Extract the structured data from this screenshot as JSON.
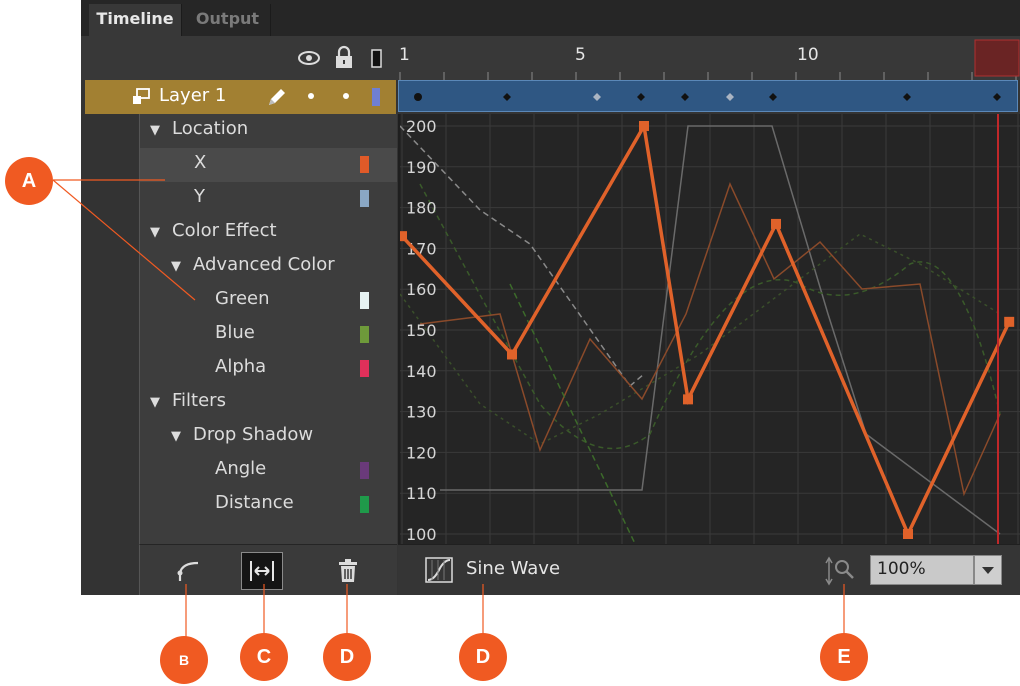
{
  "tabs": [
    {
      "label": "Timeline",
      "active": true
    },
    {
      "label": "Output",
      "active": false
    }
  ],
  "header": {
    "icons": [
      "eye-icon",
      "lock-icon",
      "outline-icon"
    ],
    "ruler_labels": [
      "1",
      "5",
      "10"
    ]
  },
  "layer": {
    "name": "Layer 1",
    "icons": [
      "layer-icon",
      "pencil-icon"
    ]
  },
  "tree": {
    "rows": [
      {
        "label": "Location",
        "level": 0,
        "expandable": true
      },
      {
        "label": "X",
        "level": 1,
        "swatch": "#e05a28",
        "selected": true
      },
      {
        "label": "Y",
        "level": 1,
        "swatch": "#8aa7c4"
      },
      {
        "label": "Color Effect",
        "level": 0,
        "expandable": true
      },
      {
        "label": "Advanced Color",
        "level": 1,
        "expandable": true
      },
      {
        "label": "Green",
        "level": 2,
        "swatch": "#e6f2f2"
      },
      {
        "label": "Blue",
        "level": 2,
        "swatch": "#6e9a3a"
      },
      {
        "label": "Alpha",
        "level": 2,
        "swatch": "#e0305a"
      },
      {
        "label": "Filters",
        "level": 0,
        "expandable": true
      },
      {
        "label": "Drop Shadow",
        "level": 1,
        "expandable": true
      },
      {
        "label": "Angle",
        "level": 2,
        "swatch": "#6a3a7a"
      },
      {
        "label": "Distance",
        "level": 2,
        "swatch": "#1f9a4a"
      }
    ]
  },
  "footer": {
    "icons": [
      "add-ease-icon",
      "fit-view-icon",
      "trash-icon"
    ],
    "ease_icon": "ease-curve-icon",
    "ease_label": "Sine Wave",
    "zoom_icon": "vertical-zoom-icon",
    "zoom_value": "100%",
    "dropdown_icon": "chevron-down-icon"
  },
  "graph": {
    "y_ticks": [
      "200",
      "190",
      "180",
      "170",
      "160",
      "150",
      "140",
      "130",
      "120",
      "110",
      "100"
    ],
    "series_x": [
      {
        "frame": 1,
        "value": 173
      },
      {
        "frame": 3.5,
        "value": 144
      },
      {
        "frame": 6.5,
        "value": 200
      },
      {
        "frame": 7.5,
        "value": 133
      },
      {
        "frame": 9.5,
        "value": 176
      },
      {
        "frame": 12.5,
        "value": 100
      },
      {
        "frame": 14.8,
        "value": 152
      }
    ]
  },
  "callouts": [
    "A",
    "B",
    "C",
    "D",
    "D",
    "E"
  ],
  "colors": {
    "accent": "#f05a22",
    "curve": "#e0622a",
    "layer_row": "#a28032",
    "keyframe_strip": "#2f5783"
  }
}
